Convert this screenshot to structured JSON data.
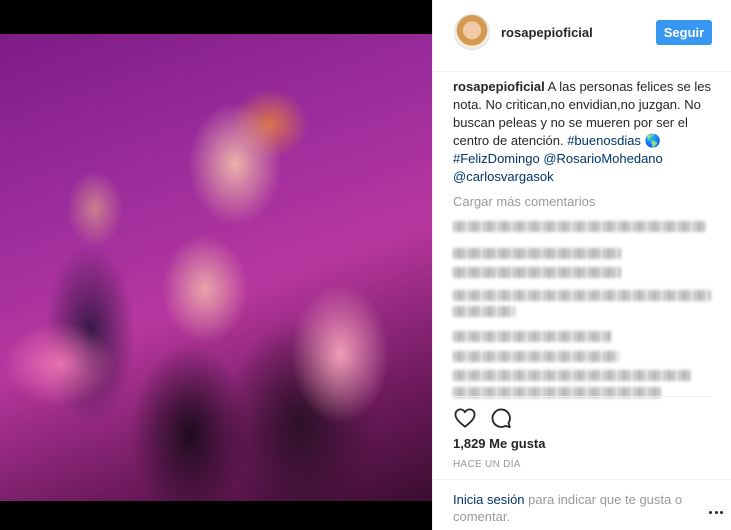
{
  "post": {
    "username": "rosapepioficial",
    "follow_label": "Seguir",
    "caption_username": "rosapepioficial",
    "caption_text": " A las personas felices se les nota. No critican,no envidian,no juzgan. No buscan peleas y no se mueren por ser el centro de atención. ",
    "tag_1": "#buenosdias",
    "emoji": " 🌎",
    "tag_2": "#FelizDomingo",
    "mention_1": "@RosarioMohedano",
    "mention_2": "@carlosvargasok",
    "load_more": "Cargar más comentarios",
    "likes": "1,829 Me gusta",
    "time": "HACE UN DÍA",
    "footer_login": "Inicia sesión",
    "footer_text": " para indicar que te gusta o comentar."
  },
  "icons": {
    "like": "heart-icon",
    "comment": "comment-icon",
    "more": "more-options-icon"
  },
  "colors": {
    "follow_button": "#3897f0",
    "link": "#003569",
    "muted": "#999999"
  }
}
